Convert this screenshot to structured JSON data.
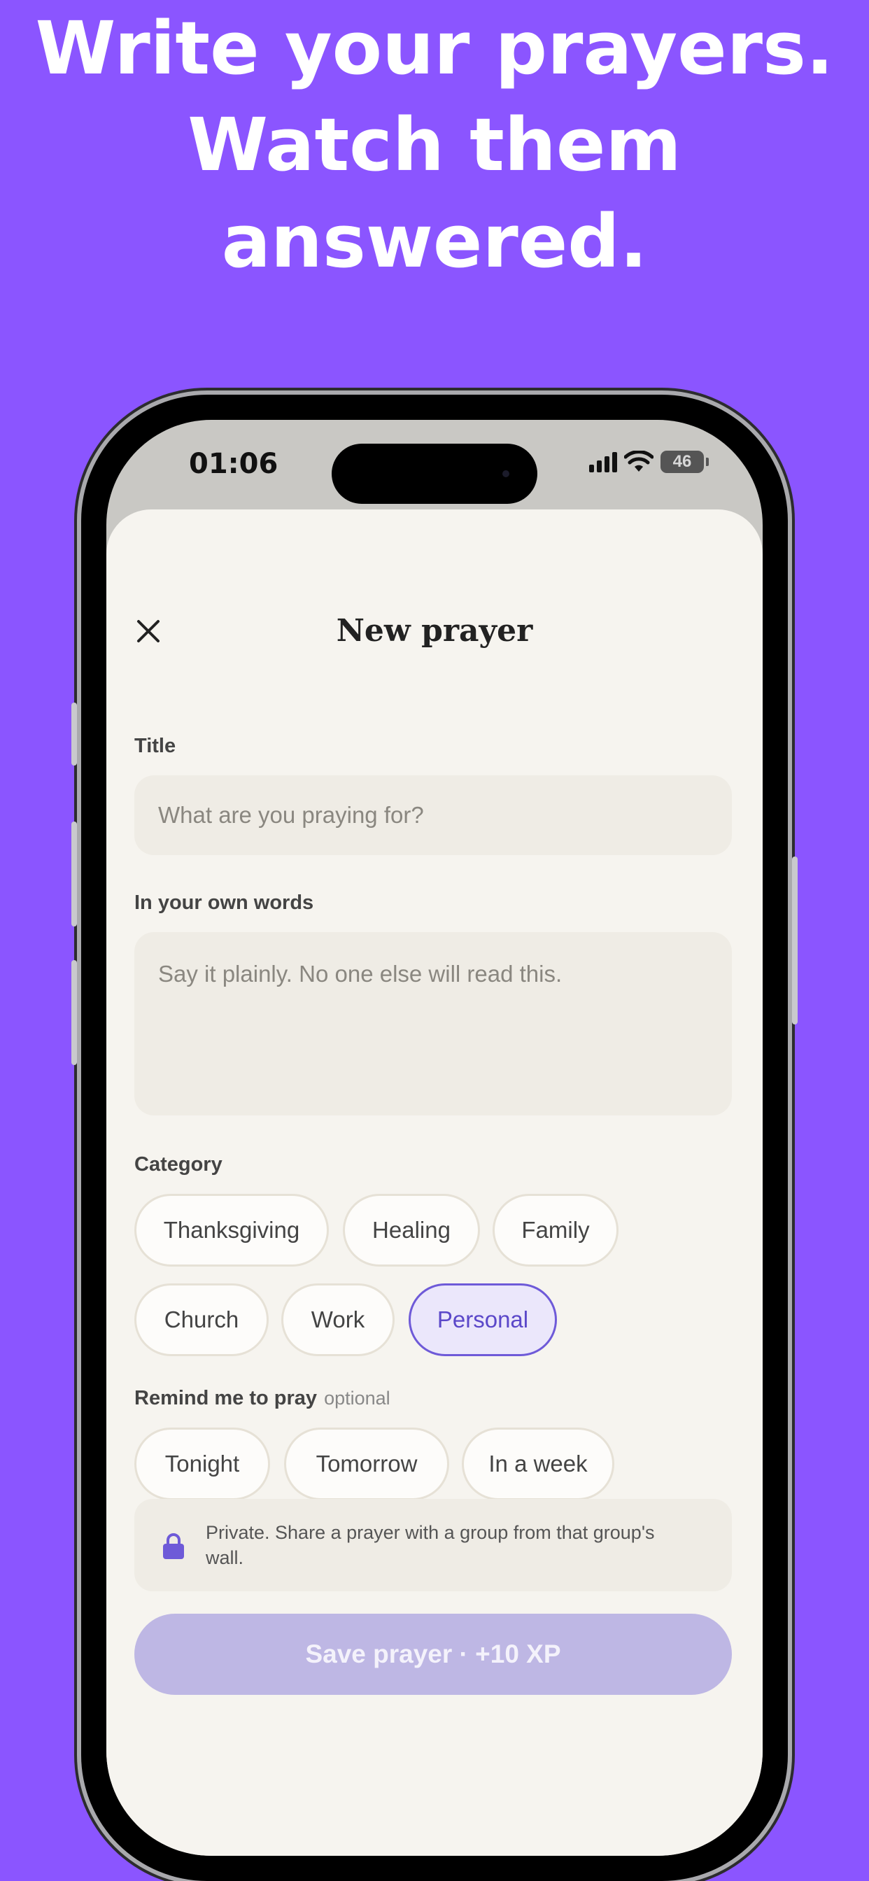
{
  "headline": {
    "line1": "Write your prayers.",
    "line2": "Watch them",
    "line3": "answered."
  },
  "status_bar": {
    "time": "01:06",
    "battery": "46",
    "icons": [
      "signal-icon",
      "wifi-icon",
      "battery-icon"
    ]
  },
  "sheet": {
    "title": "New prayer",
    "close_icon": "close-icon"
  },
  "form": {
    "title_label": "Title",
    "title_placeholder": "What are you praying for?",
    "words_label": "In your own words",
    "words_placeholder": "Say it plainly. No one else will read this.",
    "category_label": "Category",
    "categories": [
      "Thanksgiving",
      "Healing",
      "Family",
      "Church",
      "Work",
      "Personal"
    ],
    "selected_category": "Personal",
    "remind_label": "Remind me to pray",
    "remind_optional": "optional",
    "reminders": [
      "Tonight",
      "Tomorrow",
      "In a week"
    ],
    "privacy_note": "Private. Share a prayer with a group from that group's wall.",
    "lock_icon": "lock-icon",
    "save_label": "Save prayer · +10 XP"
  },
  "colors": {
    "background": "#8b55ff",
    "accent": "#6e5ad8",
    "save_disabled": "#beb7e4"
  }
}
